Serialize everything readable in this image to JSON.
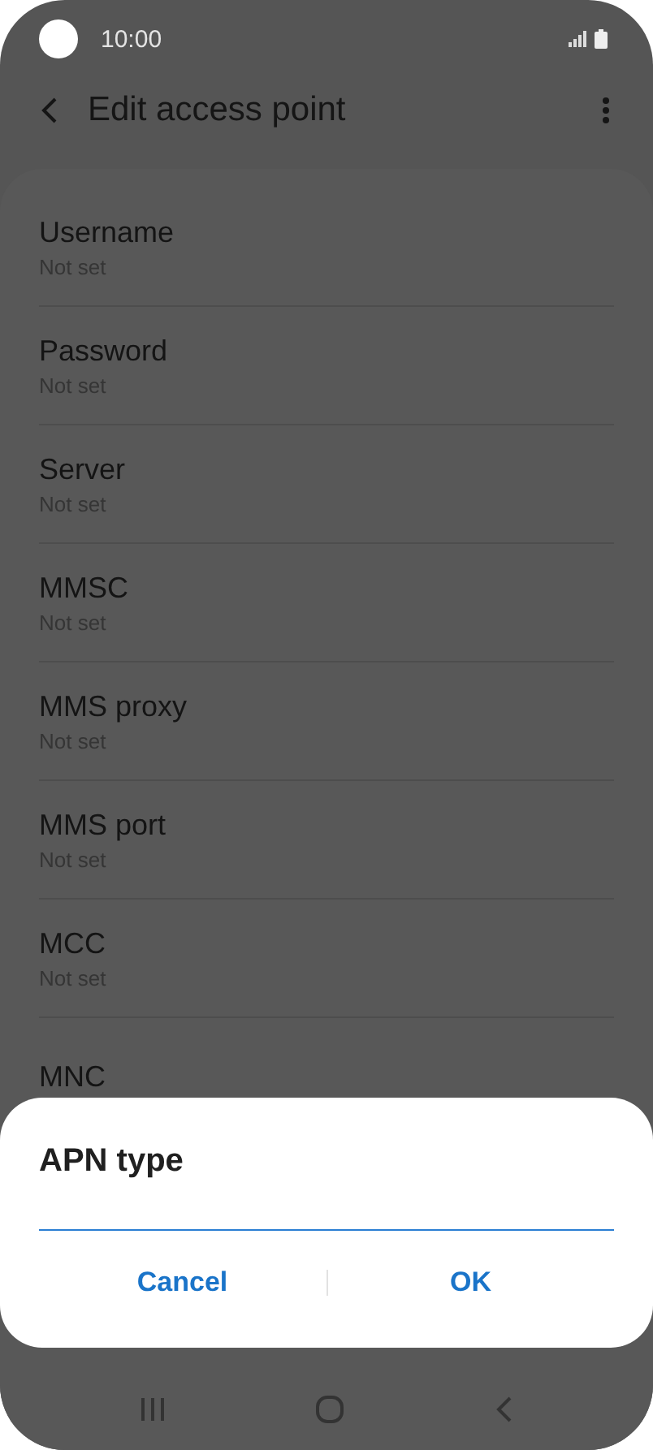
{
  "status_bar": {
    "time": "10:00"
  },
  "header": {
    "title": "Edit access point"
  },
  "items": [
    {
      "title": "Username",
      "value": "Not set"
    },
    {
      "title": "Password",
      "value": "Not set"
    },
    {
      "title": "Server",
      "value": "Not set"
    },
    {
      "title": "MMSC",
      "value": "Not set"
    },
    {
      "title": "MMS proxy",
      "value": "Not set"
    },
    {
      "title": "MMS port",
      "value": "Not set"
    },
    {
      "title": "MCC",
      "value": "Not set"
    },
    {
      "title": "MNC"
    }
  ],
  "dialog": {
    "title": "APN type",
    "buttons": [
      "Cancel",
      "OK"
    ]
  }
}
